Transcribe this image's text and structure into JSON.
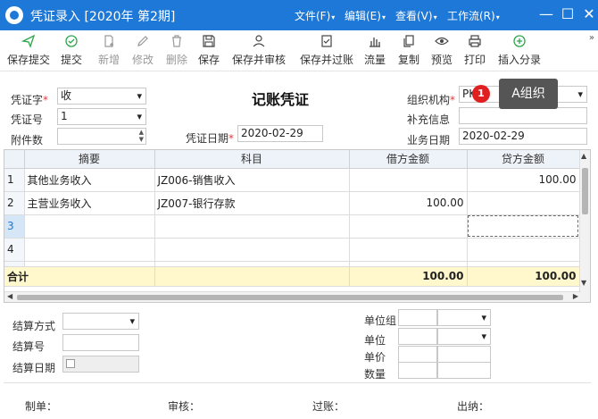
{
  "window": {
    "title": "凭证录入 [2020年 第2期]",
    "menus": [
      "文件(F)",
      "编辑(E)",
      "查看(V)",
      "工作流(R)"
    ],
    "controls": {
      "minimize": "—",
      "maximize": "☐",
      "close": "✕"
    }
  },
  "toolbar": {
    "buttons": [
      {
        "label": "保存提交",
        "icon": "send-icon",
        "enabled": true
      },
      {
        "label": "提交",
        "icon": "check-circle-icon",
        "enabled": true
      },
      {
        "label": "新增",
        "icon": "add-document-icon",
        "enabled": false
      },
      {
        "label": "修改",
        "icon": "edit-icon",
        "enabled": false
      },
      {
        "label": "删除",
        "icon": "trash-icon",
        "enabled": false
      },
      {
        "label": "保存",
        "icon": "save-icon",
        "enabled": true
      },
      {
        "label": "保存并审核",
        "icon": "user-approve-icon",
        "enabled": true
      },
      {
        "label": "保存并过账",
        "icon": "post-ledger-icon",
        "enabled": true
      },
      {
        "label": "流量",
        "icon": "bar-chart-icon",
        "enabled": true
      },
      {
        "label": "复制",
        "icon": "copy-icon",
        "enabled": true
      },
      {
        "label": "预览",
        "icon": "eye-icon",
        "enabled": true
      },
      {
        "label": "打印",
        "icon": "printer-icon",
        "enabled": true
      },
      {
        "label": "插入分录",
        "icon": "plus-circle-icon",
        "enabled": true
      }
    ],
    "more": "»"
  },
  "header": {
    "doc_title": "记账凭证",
    "voucher_word_label": "凭证字",
    "voucher_word_value": "收",
    "voucher_no_label": "凭证号",
    "voucher_no_value": "1",
    "attachments_label": "附件数",
    "attachments_value": "",
    "voucher_date_label": "凭证日期",
    "voucher_date_value": "2020-02-29",
    "org_label": "组织机构",
    "org_value": "PK",
    "supplement_label": "补充信息",
    "supplement_value": "",
    "business_date_label": "业务日期",
    "business_date_value": "2020-02-29"
  },
  "tooltip": {
    "badge": "1",
    "text": "A组织"
  },
  "grid": {
    "columns": [
      "摘要",
      "科目",
      "借方金额",
      "贷方金额"
    ],
    "rows": [
      {
        "no": "1",
        "summary": "其他业务收入",
        "account": "JZ006-销售收入",
        "debit": "",
        "credit": "100.00"
      },
      {
        "no": "2",
        "summary": "主营业务收入",
        "account": "JZ007-银行存款",
        "debit": "100.00",
        "credit": ""
      },
      {
        "no": "3",
        "summary": "",
        "account": "",
        "debit": "",
        "credit": ""
      },
      {
        "no": "4",
        "summary": "",
        "account": "",
        "debit": "",
        "credit": ""
      }
    ],
    "total_label": "合计",
    "total_debit": "100.00",
    "total_credit": "100.00"
  },
  "details": {
    "settle_method_label": "结算方式",
    "settle_method_value": "",
    "settle_no_label": "结算号",
    "settle_no_value": "",
    "settle_date_label": "结算日期",
    "unit_group_label": "单位组",
    "unit_label": "单位",
    "unit_price_label": "单价",
    "quantity_label": "数量"
  },
  "footer": {
    "maker_label": "制单：",
    "auditor_label": "审核：",
    "poster_label": "过账：",
    "cashier_label": "出纳："
  }
}
